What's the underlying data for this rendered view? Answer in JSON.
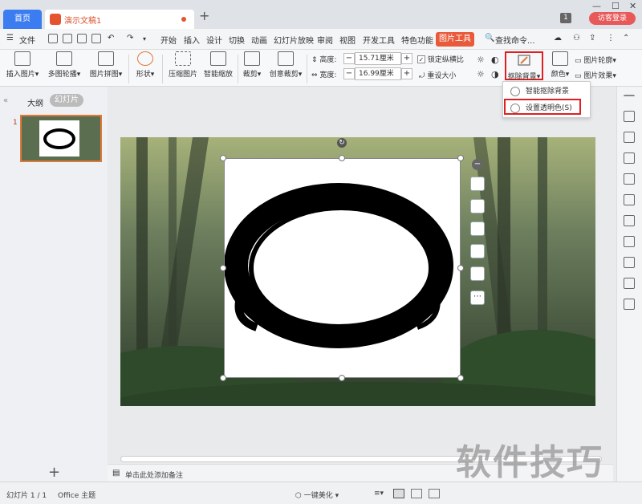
{
  "titlebar": {
    "home_tab": "首页",
    "doc_tab": "演示文稿1",
    "new_tab": "+",
    "badge": "1",
    "login": "访客登录"
  },
  "menubar": {
    "file": "文件",
    "items": [
      "开始",
      "插入",
      "设计",
      "切换",
      "动画",
      "幻灯片放映",
      "审阅",
      "视图",
      "开发工具",
      "特色功能"
    ],
    "picture_tools": "图片工具",
    "search": "查找命令..."
  },
  "ribbon": {
    "insert_picture": "插入图片",
    "multi_outline": "多图轮播",
    "picture_collage": "图片拼图",
    "shape": "形状",
    "compress": "压缩图片",
    "smart_zoom": "智能缩放",
    "crop": "裁剪",
    "creative_crop": "创意裁剪",
    "height_label": "高度:",
    "height_value": "15.71厘米",
    "width_label": "宽度:",
    "width_value": "16.99厘米",
    "lock_ratio": "锁定纵横比",
    "reset_size": "重设大小",
    "remove_bg": "抠除背景",
    "color": "颜色",
    "picture_outline": "图片轮廓",
    "picture_effect": "图片效果"
  },
  "dropdown": {
    "smart_remove": "智能抠除背景",
    "set_transparent": "设置透明色(S)"
  },
  "leftpanel": {
    "outline_tab": "大纲",
    "slides_tab": "幻灯片",
    "slide_number": "1",
    "add": "+"
  },
  "notes": {
    "placeholder": "单击此处添加备注"
  },
  "statusbar": {
    "slide_info": "幻灯片 1 / 1",
    "theme": "Office 主题",
    "beautify": "一键美化"
  },
  "watermark": "软件技巧"
}
